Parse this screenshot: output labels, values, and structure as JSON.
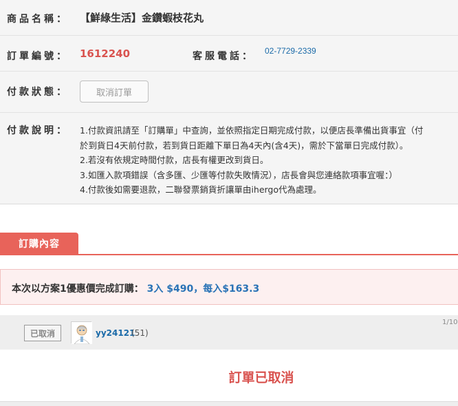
{
  "product": {
    "label": "商品名稱：",
    "name": "【鮮綠生活】金鑽蝦枝花丸"
  },
  "order": {
    "label": "訂單編號：",
    "number": "1612240"
  },
  "service": {
    "label": "客服電話：",
    "phone": "02-7729-2339"
  },
  "payment_status": {
    "label": "付款狀態：",
    "cancel_button": "取消訂單"
  },
  "payment_desc": {
    "label": "付款說明：",
    "lines": [
      "1.付款資訊請至「訂購單」中查詢，並依照指定日期完成付款，以便店長準備出貨事宜（付",
      "於到貨日4天前付款，若到貨日距離下單日為4天內(含4天)，需於下當單日完成付款）。",
      "2.若沒有依規定時間付款，店長有權更改到貨日。",
      "3.如匯入款項錯誤（含多匯、少匯等付款失敗情況），店長會與您連絡款項事宜喔：）",
      "4.付款後如需要退款，二聯發票銷貨折讓單由ihergo代為處理。"
    ]
  },
  "tab": {
    "label": "訂購內容"
  },
  "promo": {
    "text": "本次以方案1優惠價完成訂購：",
    "price": "3入 $490，每入$163.3"
  },
  "entry": {
    "status": "已取消",
    "username": "yy24121",
    "count": "(51)",
    "page": "1/10",
    "cancelled_message": "訂單已取消"
  },
  "colors": {
    "accent": "#e8635a",
    "link": "#1a6aa8",
    "alert": "#d9534f"
  }
}
